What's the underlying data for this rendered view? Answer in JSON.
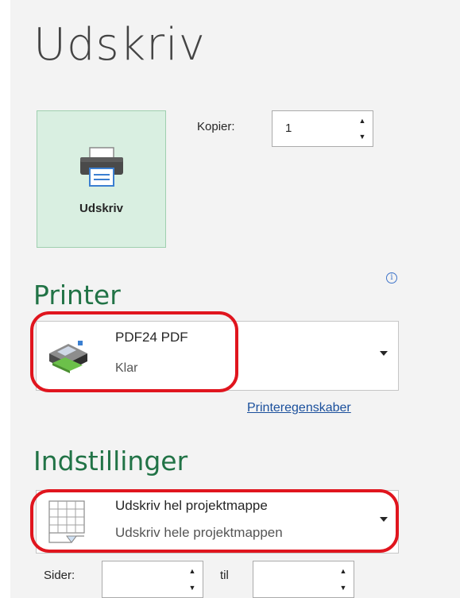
{
  "page": {
    "title": "Udskriv"
  },
  "print_button": {
    "label": "Udskriv"
  },
  "copies": {
    "label": "Kopier:",
    "value": "1"
  },
  "printer": {
    "section_title": "Printer",
    "info_icon": "info-icon",
    "name": "PDF24 PDF",
    "status": "Klar",
    "properties_link": "Printeregenskaber"
  },
  "settings": {
    "section_title": "Indstillinger",
    "scope_title": "Udskriv hel projektmappe",
    "scope_subtitle": "Udskriv hele projektmappen"
  },
  "pages": {
    "label": "Sider:",
    "to_label": "til",
    "from_value": "",
    "to_value": ""
  },
  "colors": {
    "accent": "#217346",
    "highlight": "#e0151e",
    "button_bg": "#d9efe1"
  }
}
